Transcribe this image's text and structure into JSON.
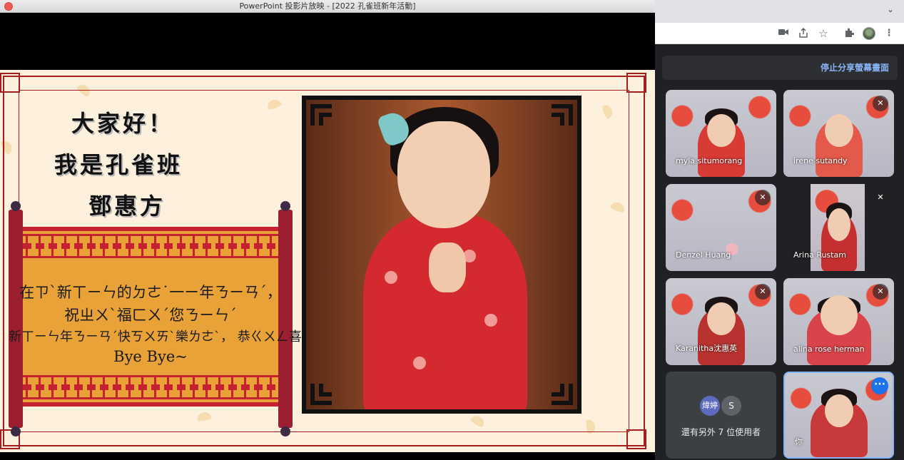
{
  "ppt": {
    "window_title": "PowerPoint 投影片放映 - [2022 孔雀班新年活動]",
    "slide": {
      "greeting_lines": [
        "大家好！",
        "我是孔雀班",
        "鄧惠方"
      ],
      "wish_lines": [
        "在ㄗˋ新ㄒㄧㄣ的ㄉㄜ˙一ㄧ年ㄋㄧㄢˊ，",
        "祝ㄓㄨˋ福ㄈㄨˊ您ㄋㄧㄣˊ",
        "新ㄒㄧㄣ年ㄋㄧㄢˊ快ㄎㄨㄞˋ樂ㄌㄜˋ， 恭ㄍㄨㄥ喜ㄒㄧˇ發ㄈㄚ財ㄘㄞˊ！",
        "Bye Bye~"
      ]
    }
  },
  "chrome": {
    "toolbar_icons": [
      "camera-icon",
      "share-icon",
      "star-icon",
      "extension-icon",
      "profile-avatar",
      "menu-icon"
    ],
    "tab_chevron": "⌄"
  },
  "meet": {
    "stop_sharing_label": "停止分享螢幕畫面",
    "participants": [
      {
        "name": "myla situmorang",
        "muted": false
      },
      {
        "name": "irene sutandy",
        "muted": true
      },
      {
        "name": "Denzel Huang",
        "muted": true
      },
      {
        "name": "Arina Rustam",
        "muted": true
      },
      {
        "name": "Karanitha沈惠英",
        "muted": true
      },
      {
        "name": "alina rose herman",
        "muted": true
      }
    ],
    "others": {
      "avatar_labels": [
        "煒婷",
        "S"
      ],
      "avatar_colors": [
        "#5c6bc0",
        "#5f6368"
      ],
      "label": "還有另外 7 位使用者"
    },
    "self_label": "你",
    "colors": {
      "accent": "#8ab4f8",
      "background": "#202124"
    }
  }
}
